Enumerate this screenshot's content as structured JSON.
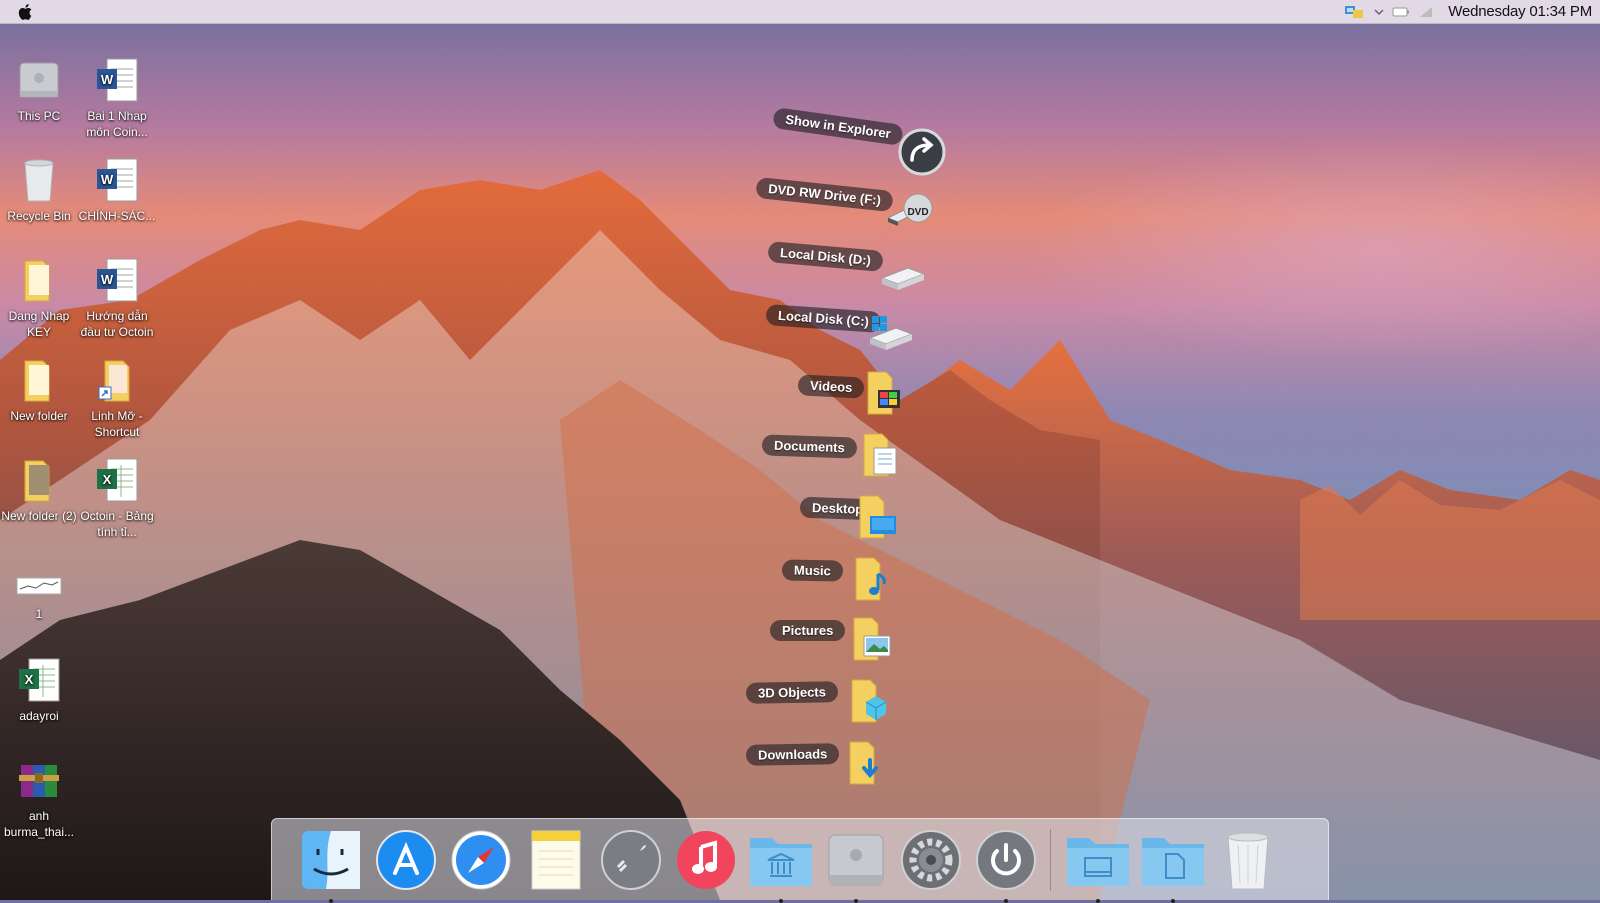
{
  "menubar": {
    "clock": "Wednesday 01:34 PM",
    "icons": [
      "apple-icon",
      "network-icon",
      "chevron-down-icon",
      "battery-icon",
      "wifi-icon"
    ]
  },
  "desktop_icons": [
    {
      "label": "This PC",
      "icon": "computer-icon"
    },
    {
      "label": "Bai 1 Nhap môn Coin...",
      "icon": "word-document-icon"
    },
    {
      "label": "Recycle Bin",
      "icon": "trash-icon"
    },
    {
      "label": "CHÍNH-SÁC...",
      "icon": "word-document-icon"
    },
    {
      "label": "Dang Nhap KEY",
      "icon": "folder-icon"
    },
    {
      "label": "Hướng dẫn đầu tư Octoin",
      "icon": "word-document-icon"
    },
    {
      "label": "New folder",
      "icon": "folder-icon"
    },
    {
      "label": "Linh Mỡ - Shortcut",
      "icon": "shortcut-folder-icon"
    },
    {
      "label": "New folder (2)",
      "icon": "folder-icon"
    },
    {
      "label": "Octoin - Bảng tính tỉ...",
      "icon": "excel-document-icon"
    },
    {
      "label": "1",
      "icon": "image-thumbnail-icon"
    },
    {
      "label": "adayroi",
      "icon": "excel-document-icon"
    },
    {
      "label": "anh burma_thai...",
      "icon": "winrar-archive-icon"
    }
  ],
  "stack_menu": [
    {
      "label": "Show in Explorer",
      "icon": "arrow-forward-icon"
    },
    {
      "label": "DVD RW Drive (F:)",
      "icon": "dvd-drive-icon"
    },
    {
      "label": "Local Disk (D:)",
      "icon": "hard-drive-icon"
    },
    {
      "label": "Local Disk (C:)",
      "icon": "system-drive-icon"
    },
    {
      "label": "Videos",
      "icon": "videos-folder-icon"
    },
    {
      "label": "Documents",
      "icon": "documents-folder-icon"
    },
    {
      "label": "Desktop",
      "icon": "desktop-folder-icon"
    },
    {
      "label": "Music",
      "icon": "music-folder-icon"
    },
    {
      "label": "Pictures",
      "icon": "pictures-folder-icon"
    },
    {
      "label": "3D Objects",
      "icon": "3d-objects-folder-icon"
    },
    {
      "label": "Downloads",
      "icon": "downloads-folder-icon"
    }
  ],
  "dock": [
    {
      "name": "finder",
      "icon": "finder-icon",
      "running": true
    },
    {
      "name": "app-store",
      "icon": "app-store-icon",
      "running": false
    },
    {
      "name": "safari",
      "icon": "safari-icon",
      "running": false
    },
    {
      "name": "notes",
      "icon": "notes-icon",
      "running": false
    },
    {
      "name": "launchpad",
      "icon": "rocket-icon",
      "running": false
    },
    {
      "name": "itunes",
      "icon": "music-note-icon",
      "running": false
    },
    {
      "name": "applications-folder",
      "icon": "applications-folder-icon",
      "running": true
    },
    {
      "name": "computer",
      "icon": "computer-icon",
      "running": true
    },
    {
      "name": "system-preferences",
      "icon": "gear-icon",
      "running": false
    },
    {
      "name": "shutdown",
      "icon": "power-icon",
      "running": true
    },
    {
      "name": "desktop-stack",
      "icon": "desktop-folder-icon",
      "running": true
    },
    {
      "name": "documents-stack",
      "icon": "documents-folder-icon",
      "running": true
    },
    {
      "name": "trash",
      "icon": "trash-icon",
      "running": false
    }
  ]
}
